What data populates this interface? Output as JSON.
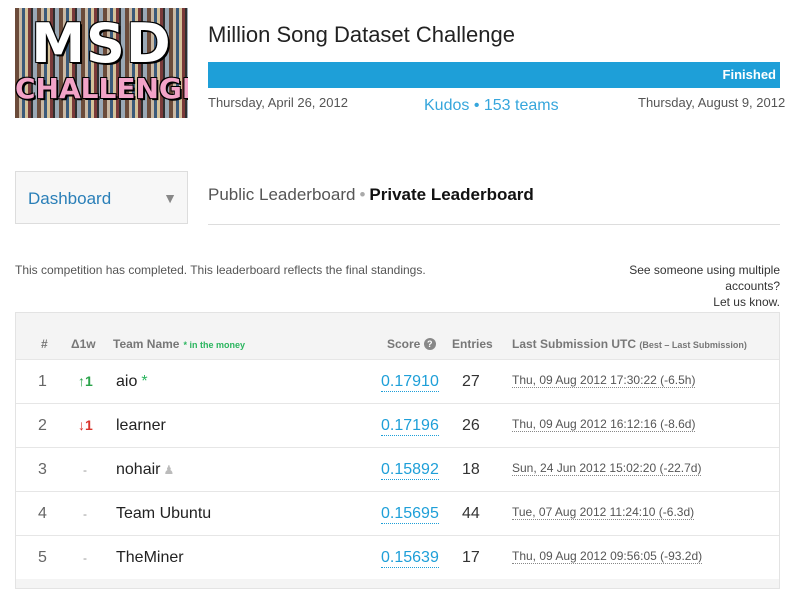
{
  "logo": {
    "line1": "MSD",
    "line2": "CHALLENGE"
  },
  "competition": {
    "title": "Million Song Dataset Challenge",
    "status": "Finished",
    "start_date": "Thursday, April 26, 2012",
    "end_date": "Thursday, August 9, 2012",
    "kudos": "Kudos • 153 teams",
    "progress_percent": 100,
    "accent_color": "#1e9fd8"
  },
  "nav": {
    "dashboard_label": "Dashboard",
    "dashboard_icon": "triangle-down-icon",
    "tabs": [
      {
        "label": "Public Leaderboard",
        "active": false
      },
      {
        "label": "Private Leaderboard",
        "active": true
      }
    ],
    "separator": "•"
  },
  "notice": "This competition has completed. This leaderboard reflects the final standings.",
  "multiple_accounts": {
    "line1": "See someone using multiple",
    "line2": "accounts?",
    "link": "Let us know."
  },
  "leaderboard": {
    "headers": {
      "rank": "#",
      "delta": "Δ1w",
      "team": "Team Name",
      "money": "* in the money",
      "score": "Score",
      "score_help": "?",
      "entries": "Entries",
      "last": "Last Submission UTC",
      "last_sub": "(Best – Last Submission)"
    },
    "rows": [
      {
        "rank": "1",
        "delta": "↑1",
        "delta_dir": "up",
        "team": "aio",
        "star": "*",
        "person_icon": false,
        "score": "0.17910",
        "entries": "27",
        "last": "Thu, 09 Aug 2012 17:30:22 (-6.5h)"
      },
      {
        "rank": "2",
        "delta": "↓1",
        "delta_dir": "down",
        "team": "learner",
        "star": "",
        "person_icon": false,
        "score": "0.17196",
        "entries": "26",
        "last": "Thu, 09 Aug 2012 16:12:16 (-8.6d)"
      },
      {
        "rank": "3",
        "delta": "-",
        "delta_dir": "flat",
        "team": "nohair",
        "star": "",
        "person_icon": true,
        "score": "0.15892",
        "entries": "18",
        "last": "Sun, 24 Jun 2012 15:02:20 (-22.7d)"
      },
      {
        "rank": "4",
        "delta": "-",
        "delta_dir": "flat",
        "team": "Team Ubuntu",
        "star": "",
        "person_icon": false,
        "score": "0.15695",
        "entries": "44",
        "last": "Tue, 07 Aug 2012 11:24:10 (-6.3d)"
      },
      {
        "rank": "5",
        "delta": "-",
        "delta_dir": "flat",
        "team": "TheMiner",
        "star": "",
        "person_icon": false,
        "score": "0.15639",
        "entries": "17",
        "last": "Thu, 09 Aug 2012 09:56:05 (-93.2d)"
      }
    ]
  }
}
